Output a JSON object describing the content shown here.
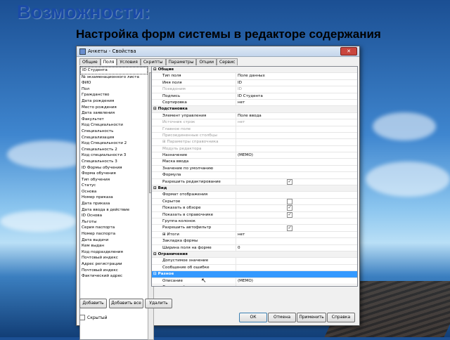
{
  "slide": {
    "title": "Возможности:",
    "subtitle": "Настройка форм системы в редакторе содержания"
  },
  "window": {
    "title": "Анкеты - Свойства",
    "close_glyph": "✕",
    "tabs": [
      "Общие",
      "Поля",
      "Условия",
      "Скрипты",
      "Параметры",
      "Опции",
      "Сервис"
    ],
    "active_tab": 1
  },
  "field_list": {
    "items": [
      "ID Студента",
      "№ экзаменационного листа",
      "ФИО",
      "Пол",
      "Гражданство",
      "Дата рождения",
      "Место рождения",
      "Дата заявления",
      "Факультет",
      "Код Специальности",
      "Специальность",
      "Специализация",
      "Код Специальности 2",
      "Специальность 2",
      "Код специальности 3",
      "Специальность 3",
      "ID Формы обучения",
      "Форма обучения",
      "Тип обучения",
      "Статус",
      "Основа",
      "Номер приказа",
      "Дата приказа",
      "Дата ввода в действие",
      "ID Основа",
      "Льготы",
      "Серия паспорта",
      "Номер паспорта",
      "Дата выдачи",
      "Кем выдан",
      "Код подразделения",
      "Почтовый индекс",
      "Адрес регистрации",
      "Почтовый индекс",
      "Фактический адрес"
    ],
    "selected": 0
  },
  "properties": [
    {
      "type": "cat",
      "label": "⊟ Общие"
    },
    {
      "label": "Тип поля",
      "value": "Поле данных"
    },
    {
      "label": "Имя поля",
      "value": "ID"
    },
    {
      "label": "Псевдоним",
      "value": "ID",
      "disabled": true
    },
    {
      "label": "Подпись",
      "value": "ID Студента"
    },
    {
      "label": "Сортировка",
      "value": "нет"
    },
    {
      "type": "cat",
      "label": "⊟ Подстановка"
    },
    {
      "label": "Элемент управления",
      "value": "Поле ввода"
    },
    {
      "label": "Источник строк",
      "value": "нет",
      "disabled": true
    },
    {
      "label": "Главное поле",
      "value": "",
      "disabled": true
    },
    {
      "label": "Присоединенные столбцы",
      "value": "",
      "disabled": true
    },
    {
      "label": "⊞ Параметры справочника",
      "value": "",
      "disabled": true
    },
    {
      "label": "Модуль редактора",
      "value": "",
      "disabled": true
    },
    {
      "label": "Назначение",
      "value": "(MEMO)"
    },
    {
      "label": "Маска ввода",
      "value": ""
    },
    {
      "label": "Значение по умолчанию",
      "value": ""
    },
    {
      "label": "Формула",
      "value": ""
    },
    {
      "label": "Разрешить редактирование",
      "value": "",
      "check": "✓"
    },
    {
      "type": "cat",
      "label": "⊟ Вид"
    },
    {
      "label": "Формат отображения",
      "value": ""
    },
    {
      "label": "Скрытое",
      "value": "",
      "check": ""
    },
    {
      "label": "Показать в обзоре",
      "value": "",
      "check": "✓"
    },
    {
      "label": "Показать в справочнике",
      "value": "",
      "check": "✓"
    },
    {
      "label": "Группа колонок",
      "value": ""
    },
    {
      "label": "Разрешить автофильтр",
      "value": "",
      "check": "✓"
    },
    {
      "label": "⊞ Итоги",
      "value": "нет"
    },
    {
      "label": "Закладка формы",
      "value": ""
    },
    {
      "label": "Ширина поля на форме",
      "value": "0"
    },
    {
      "type": "cat",
      "label": "⊟ Ограничения"
    },
    {
      "label": "Допустимое значение",
      "value": ""
    },
    {
      "label": "Сообщение об ошибке",
      "value": ""
    },
    {
      "type": "cat",
      "label": "⊟ Разное",
      "selected": true
    },
    {
      "label": "Описание",
      "value": "(MEMO)"
    },
    {
      "label": "Связанный модуль",
      "value": ""
    }
  ],
  "buttons": {
    "add": "Добавить",
    "add_all": "Добавить все",
    "delete": "Удалить",
    "ok": "ОК",
    "cancel": "Отмена",
    "apply": "Применить",
    "help": "Справка"
  },
  "hidden_checkbox_label": "Скрытый"
}
